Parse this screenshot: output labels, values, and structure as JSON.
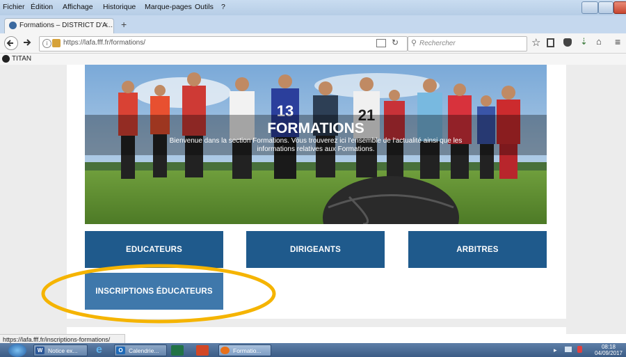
{
  "menu": [
    "Fichier",
    "Édition",
    "Affichage",
    "Historique",
    "Marque-pages",
    "Outils",
    "?"
  ],
  "tab": {
    "title": "Formations – DISTRICT D'A...",
    "close": "×",
    "new": "+"
  },
  "nav": {
    "url": "https://lafa.fff.fr/formations/",
    "search_placeholder": "Rechercher"
  },
  "bookmarks": [
    {
      "label": "TITAN"
    }
  ],
  "hero": {
    "title": "FORMATIONS",
    "subtitle_line1": "Bienvenue dans la section Formations. Vous trouverez ici l'ensemble de l'actualité ainsi que les",
    "subtitle_line2": "informations relatives aux Formations.",
    "jersey_left": "13",
    "jersey_right": "21"
  },
  "buttons": {
    "educateurs": "EDUCATEURS",
    "dirigeants": "DIRIGEANTS",
    "arbitres": "ARBITRES",
    "inscriptions": "INSCRIPTIONS ÉDUCATEURS"
  },
  "status": {
    "url": "https://lafa.fff.fr/inscriptions-formations/"
  },
  "taskbar": {
    "items": [
      {
        "label": "Notice ex..."
      },
      {
        "label": "Calendrie..."
      },
      {
        "label": "Formatio..."
      }
    ],
    "time": "08:18",
    "date": "04/09/2017"
  },
  "colors": {
    "button_blue": "#1f5a8c",
    "button_highlight": "#3f78ab",
    "highlight_ellipse": "#f5b400",
    "page_bg": "#ececec"
  }
}
